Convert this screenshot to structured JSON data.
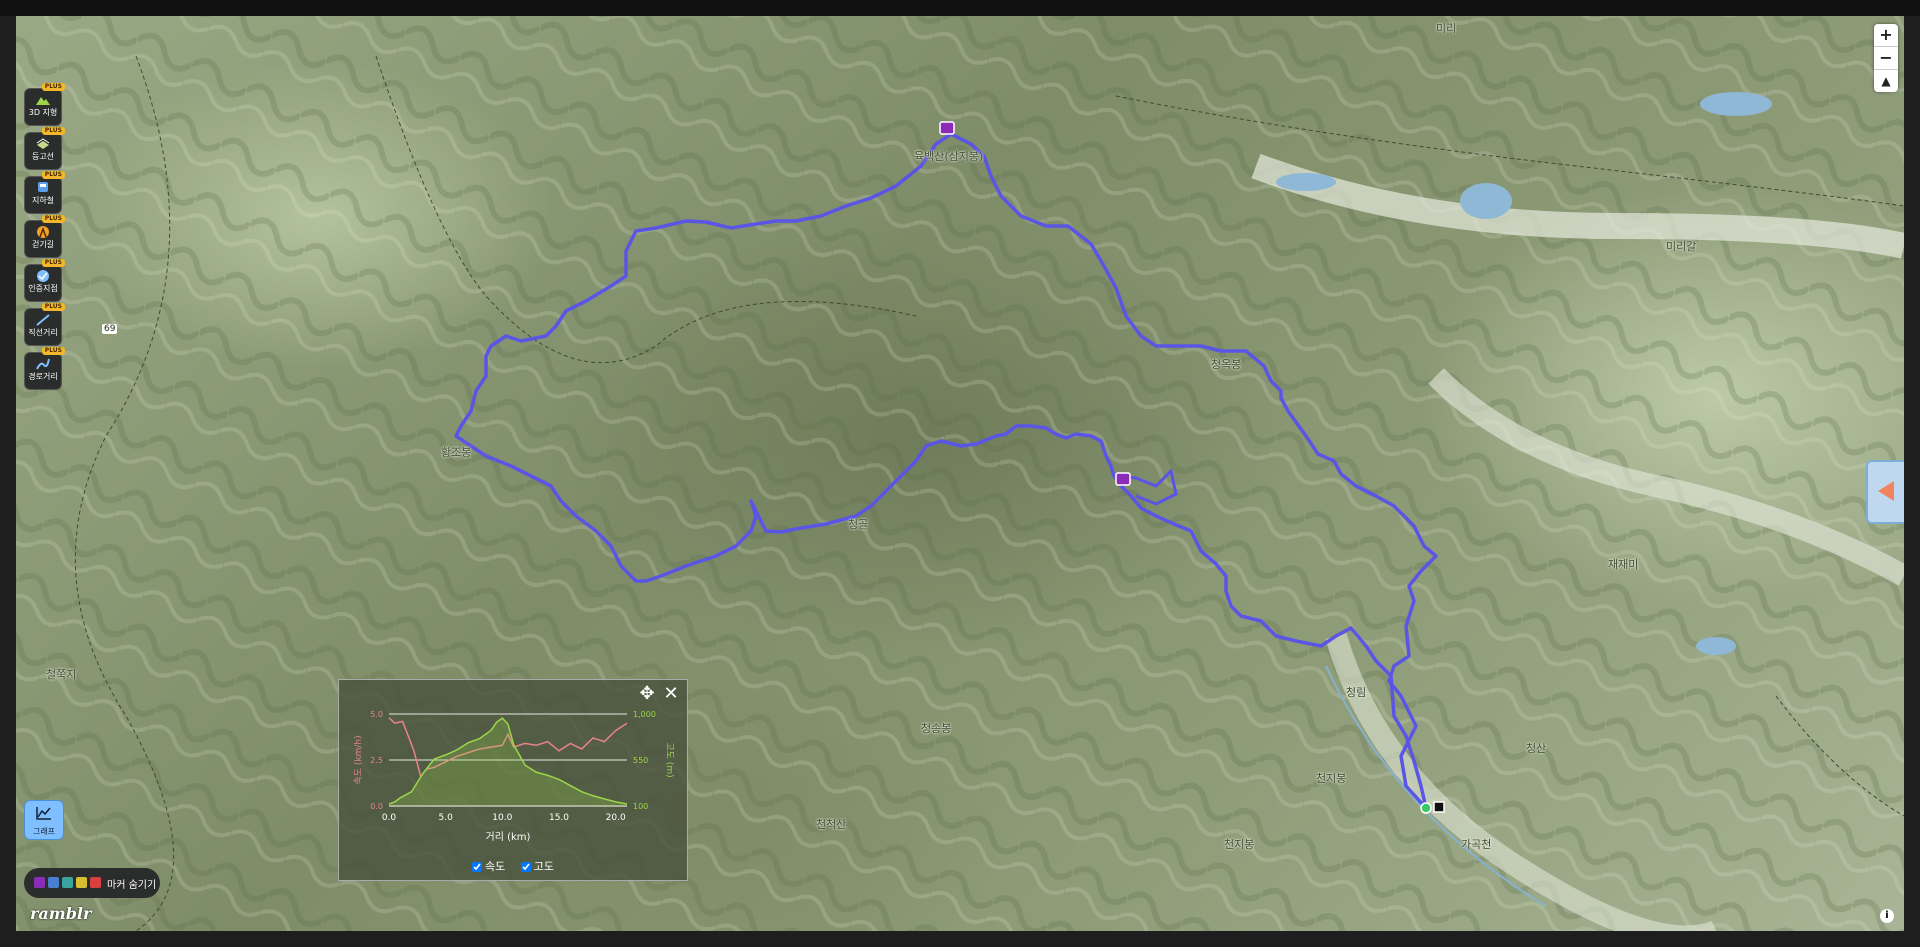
{
  "map": {
    "labels": [
      {
        "name": "label-peak-1",
        "text": "육백산(삼지봉)"
      },
      {
        "name": "label-peak-2",
        "text": "청옥봉"
      },
      {
        "name": "label-peak-3",
        "text": "황조봉"
      },
      {
        "name": "label-peak-4",
        "text": "청송봉"
      },
      {
        "name": "label-peak-5",
        "text": "철쭉지"
      },
      {
        "name": "label-peak-6",
        "text": "천척산"
      },
      {
        "name": "label-peak-7",
        "text": "천지봉"
      },
      {
        "name": "label-peak-8",
        "text": "천지봉"
      },
      {
        "name": "label-peak-9",
        "text": "청산"
      },
      {
        "name": "label-peak-10",
        "text": "청골"
      },
      {
        "name": "label-village-1",
        "text": "미리갈"
      },
      {
        "name": "label-village-2",
        "text": "재재미"
      },
      {
        "name": "label-village-3",
        "text": "미리"
      },
      {
        "name": "label-road-1",
        "text": "69"
      },
      {
        "name": "label-road-2",
        "text": "청림"
      },
      {
        "name": "label-road-3",
        "text": "가곡천"
      }
    ],
    "route_color": "#5b55e6"
  },
  "toolbar": {
    "badge": "PLUS",
    "items": [
      {
        "label": "3D 지형",
        "icon": "terrain-3d-icon"
      },
      {
        "label": "등고선",
        "icon": "contour-layers-icon"
      },
      {
        "label": "지하철",
        "icon": "subway-icon"
      },
      {
        "label": "걷기길",
        "icon": "walking-trail-icon"
      },
      {
        "label": "인증지점",
        "icon": "certified-spot-icon"
      },
      {
        "label": "직선거리",
        "icon": "ruler-line-icon"
      },
      {
        "label": "경로거리",
        "icon": "route-distance-icon"
      }
    ]
  },
  "zoom": {
    "in": "+",
    "out": "−",
    "compass": "▲"
  },
  "graph_button": {
    "label": "그래프"
  },
  "marker_toggle": {
    "label": "마커 숨기기"
  },
  "logo": {
    "text": "ramblr"
  },
  "info_button": {
    "label": "i"
  },
  "elevation_panel": {
    "move_icon": "✥",
    "close_icon": "✕",
    "legend": {
      "speed": "속도",
      "altitude": "고도"
    }
  },
  "chart_data": {
    "type": "line",
    "xlabel": "거리 (km)",
    "ylabel_left": "속도 (km/h)",
    "ylabel_right": "고도 (m)",
    "xlim": [
      0,
      21
    ],
    "ylim_left": [
      0,
      5
    ],
    "ylim_right": [
      100,
      1000
    ],
    "x_ticks": [
      "0.0",
      "5.0",
      "10.0",
      "15.0",
      "20.0"
    ],
    "y_left_ticks": [
      "0.0",
      "2.5",
      "5.0"
    ],
    "y_right_ticks": [
      "100",
      "550",
      "1,000"
    ],
    "grid": true,
    "series": [
      {
        "name": "속도",
        "color": "#e8838a",
        "axis": "left",
        "x": [
          0,
          0.5,
          1.2,
          1.7,
          2.2,
          2.8,
          3.3,
          4,
          5,
          6,
          7,
          8,
          9,
          10,
          10.5,
          11,
          12,
          13,
          14,
          15,
          16,
          17,
          18,
          19,
          20,
          21
        ],
        "y": [
          4.8,
          4.5,
          4.6,
          3.8,
          3.0,
          1.6,
          2.0,
          2.1,
          2.4,
          2.7,
          2.9,
          3.1,
          3.2,
          3.3,
          3.9,
          3.2,
          3.4,
          3.3,
          3.5,
          3.0,
          3.4,
          3.1,
          3.7,
          3.5,
          4.1,
          4.5
        ]
      },
      {
        "name": "고도",
        "color": "#9bd64a",
        "axis": "right",
        "x": [
          0,
          0.5,
          1,
          2,
          3,
          4,
          5,
          6,
          7,
          8,
          9,
          9.5,
          10,
          10.5,
          11,
          12,
          13,
          14,
          15,
          16,
          17,
          18,
          19,
          20,
          21
        ],
        "y": [
          120,
          140,
          180,
          240,
          420,
          560,
          600,
          650,
          720,
          760,
          840,
          920,
          960,
          900,
          700,
          500,
          430,
          400,
          360,
          300,
          240,
          200,
          170,
          140,
          120
        ]
      }
    ]
  }
}
